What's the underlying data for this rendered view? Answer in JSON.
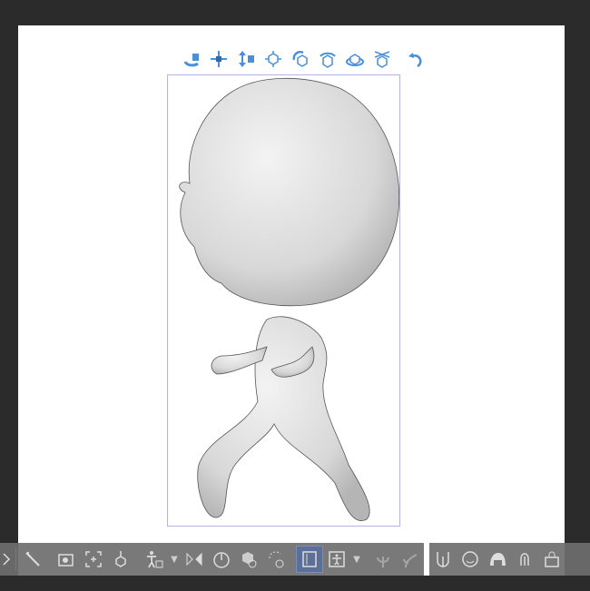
{
  "colors": {
    "accent": "#4a90d9",
    "background": "#2b2b2b",
    "canvas": "#ffffff",
    "bbox": "#b4b4e6",
    "toolbar": "#6e6e6e",
    "active": "#5c6f96"
  },
  "manipulator_icons": [
    "camera-rotate-icon",
    "camera-pan-icon",
    "camera-dolly-icon",
    "move-icon",
    "rotate-icon",
    "rotate-x-icon",
    "rotate-y-icon",
    "move-on-plane-icon",
    "reset-rotation-icon"
  ],
  "toolbar_icons": [
    "expand-arrow-icon",
    "wrench-icon",
    "camera-icon",
    "fit-icon",
    "ground-icon",
    "body-add-icon",
    "flip-icon",
    "timer-icon",
    "object-rotate-icon",
    "rotate-reset-icon",
    "lock-joints-icon",
    "pose-icon",
    "plant-icon",
    "plant-alt-icon",
    "body-shape-icon",
    "face-icon",
    "hair-icon",
    "head-icon",
    "bag-icon"
  ]
}
